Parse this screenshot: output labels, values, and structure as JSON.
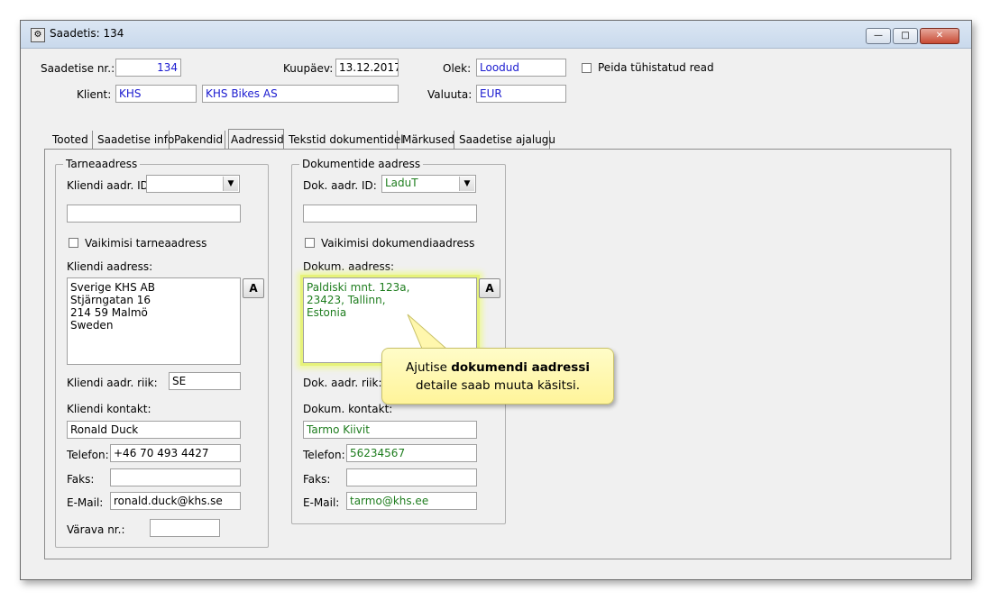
{
  "window": {
    "title": "Saadetis: 134",
    "min_label": "—",
    "max_label": "□",
    "close_label": "✕"
  },
  "header": {
    "shipment_no_label": "Saadetise nr.:",
    "shipment_no": "134",
    "date_label": "Kuupäev:",
    "date": "13.12.2017",
    "status_label": "Olek:",
    "status": "Loodud",
    "hide_deleted_label": "Peida tühistatud read",
    "client_label": "Klient:",
    "client_code": "KHS",
    "client_name": "KHS Bikes AS",
    "currency_label": "Valuuta:",
    "currency": "EUR"
  },
  "tabs": [
    {
      "label": "Tooted"
    },
    {
      "label": "Saadetise info"
    },
    {
      "label": "Pakendid"
    },
    {
      "label": "Aadressid"
    },
    {
      "label": "Tekstid dokumentidel"
    },
    {
      "label": "Märkused"
    },
    {
      "label": "Saadetise ajalugu"
    }
  ],
  "delivery": {
    "group_title": "Tarneaadress",
    "addr_id_label": "Kliendi aadr. ID:",
    "addr_id_value": "",
    "default_label": "Vaikimisi tarneaadress",
    "address_label": "Kliendi aadress:",
    "address": "Sverige KHS AB\nStjärngatan 16\n214 59 Malmö\nSweden",
    "edit_button": "A",
    "country_label": "Kliendi aadr. riik:",
    "country": "SE",
    "contact_label": "Kliendi kontakt:",
    "contact": "Ronald Duck",
    "phone_label": "Telefon:",
    "phone": "+46 70 493 4427",
    "fax_label": "Faks:",
    "fax": "",
    "email_label": "E-Mail:",
    "email": "ronald.duck@khs.se",
    "gate_label": "Värava nr.:",
    "gate": ""
  },
  "documents": {
    "group_title": "Dokumentide aadress",
    "addr_id_label": "Dok. aadr. ID:",
    "addr_id_value": "LaduT",
    "default_label": "Vaikimisi dokumendiaadress",
    "address_label": "Dokum. aadress:",
    "address": "Paldiski mnt. 123a,\n23423, Tallinn,\nEstonia",
    "edit_button": "A",
    "country_label": "Dok. aadr. riik:",
    "contact_label": "Dokum. kontakt:",
    "contact": "Tarmo Kiivit",
    "phone_label": "Telefon:",
    "phone": "56234567",
    "fax_label": "Faks:",
    "fax": "",
    "email_label": "E-Mail:",
    "email": "tarmo@khs.ee"
  },
  "callout": {
    "prefix": "Ajutise ",
    "bold": "dokumendi aadressi",
    "line2": "detaile saab muuta käsitsi."
  },
  "colors": {
    "linked_value": "#1a1ad0",
    "document_value": "#1e7d1e",
    "callout_bg": "#fff49a"
  }
}
